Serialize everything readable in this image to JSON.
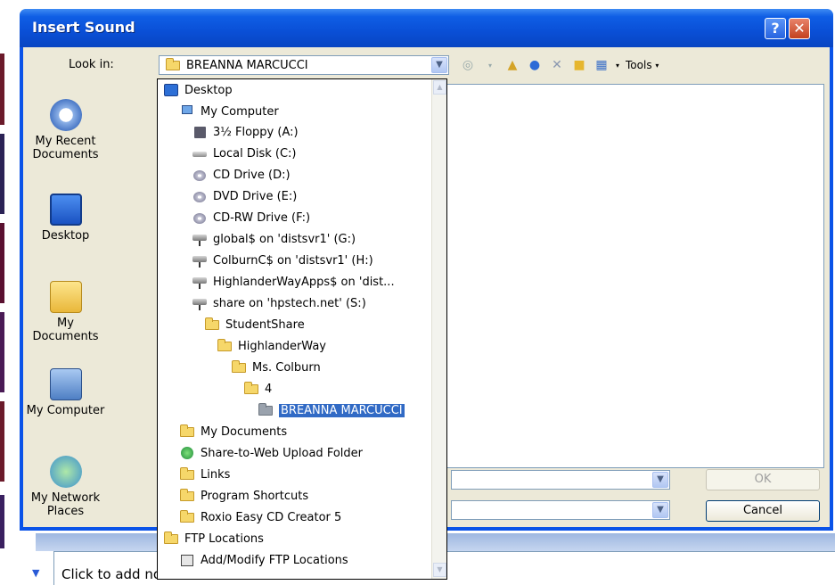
{
  "dialog": {
    "title": "Insert Sound",
    "help_button": "?",
    "close_button": "✕"
  },
  "lookin": {
    "label": "Look in:",
    "value": "BREANNA MARCUCCI"
  },
  "toolbar": {
    "tools_label": "Tools"
  },
  "places": [
    {
      "label": "My Recent Documents",
      "icon": "recent-documents-icon"
    },
    {
      "label": "Desktop",
      "icon": "desktop-icon"
    },
    {
      "label": "My Documents",
      "icon": "my-documents-icon"
    },
    {
      "label": "My Computer",
      "icon": "my-computer-icon"
    },
    {
      "label": "My Network Places",
      "icon": "network-places-icon"
    }
  ],
  "buttons": {
    "ok": "OK",
    "cancel": "Cancel"
  },
  "dropdown": {
    "items": [
      {
        "label": "Desktop",
        "icon": "desktop-icon"
      },
      {
        "label": "My Computer",
        "icon": "computer-icon"
      },
      {
        "label": "3½ Floppy (A:)",
        "icon": "floppy-icon"
      },
      {
        "label": "Local Disk (C:)",
        "icon": "drive-icon"
      },
      {
        "label": "CD Drive (D:)",
        "icon": "cd-icon"
      },
      {
        "label": "DVD Drive (E:)",
        "icon": "cd-icon"
      },
      {
        "label": "CD-RW Drive (F:)",
        "icon": "cd-icon"
      },
      {
        "label": "global$ on 'distsvr1' (G:)",
        "icon": "network-drive-icon"
      },
      {
        "label": "ColburnC$ on 'distsvr1' (H:)",
        "icon": "network-drive-icon"
      },
      {
        "label": "HighlanderWayApps$ on 'dist...",
        "icon": "network-drive-icon"
      },
      {
        "label": "share on 'hpstech.net' (S:)",
        "icon": "network-drive-icon"
      },
      {
        "label": "StudentShare",
        "icon": "folder-icon"
      },
      {
        "label": "HighlanderWay",
        "icon": "folder-icon"
      },
      {
        "label": "Ms. Colburn",
        "icon": "folder-icon"
      },
      {
        "label": "4",
        "icon": "folder-icon"
      },
      {
        "label": "BREANNA MARCUCCI",
        "icon": "folder-open-icon",
        "selected": true
      },
      {
        "label": "My Documents",
        "icon": "my-documents-icon"
      },
      {
        "label": "Share-to-Web Upload Folder",
        "icon": "web-upload-icon"
      },
      {
        "label": "Links",
        "icon": "folder-icon"
      },
      {
        "label": "Program Shortcuts",
        "icon": "folder-icon"
      },
      {
        "label": "Roxio Easy CD Creator 5",
        "icon": "folder-icon"
      },
      {
        "label": "FTP Locations",
        "icon": "folder-icon"
      },
      {
        "label": "Add/Modify FTP Locations",
        "icon": "ftp-icon"
      }
    ]
  },
  "background": {
    "notes_placeholder": "Click to add no"
  },
  "colors": {
    "title_bar": "#0a4fd6",
    "dialog_face": "#ece9d8",
    "selection": "#316ac5"
  }
}
